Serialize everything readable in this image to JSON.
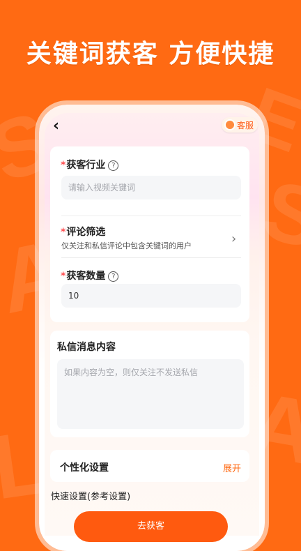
{
  "headline": "关键词获客 方便快捷",
  "header": {
    "service_label": "客服"
  },
  "industry": {
    "required_mark": "*",
    "label": "获客行业",
    "placeholder": "请输入视频关键词"
  },
  "comment_filter": {
    "required_mark": "*",
    "label": "评论筛选",
    "description": "仅关注和私信评论中包含关键词的用户"
  },
  "quantity": {
    "required_mark": "*",
    "label": "获客数量",
    "value": "10"
  },
  "message": {
    "label": "私信消息内容",
    "placeholder": "如果内容为空，则仅关注不发送私信"
  },
  "personal": {
    "label": "个性化设置",
    "expand_label": "展开"
  },
  "quick_settings_label": "快速设置(参考设置)",
  "submit_label": "去获客",
  "icons": {
    "back": "chevron-left-icon",
    "help": "question-circle-icon",
    "chevron": "chevron-right-icon",
    "service_avatar": "service-avatar-icon"
  },
  "colors": {
    "brand": "#ff6a13",
    "button": "#ff5a0f",
    "required": "#ff4d4f"
  }
}
